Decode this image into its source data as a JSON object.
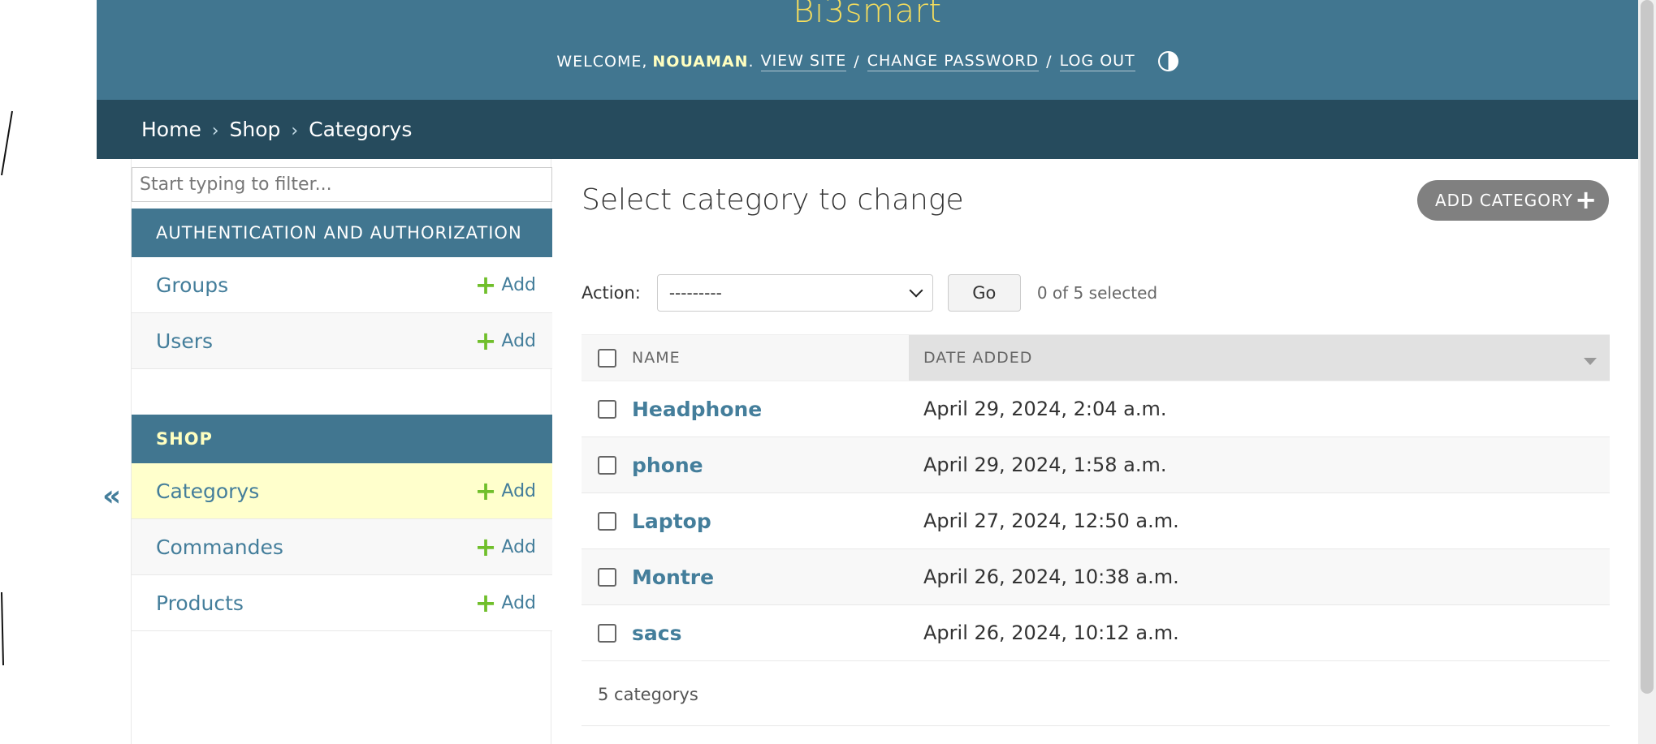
{
  "header": {
    "brand": "Bi3smart",
    "welcome": "WELCOME,",
    "username": "NOUAMAN",
    "user_suffix": ".",
    "view_site": "VIEW SITE",
    "change_password": "CHANGE PASSWORD",
    "log_out": "LOG OUT",
    "separator": "/"
  },
  "breadcrumbs": {
    "home": "Home",
    "shop": "Shop",
    "current": "Categorys",
    "arrow": "›"
  },
  "sidebar": {
    "filter_placeholder": "Start typing to filter...",
    "toggle": "«",
    "auth_module": {
      "caption": "AUTHENTICATION AND AUTHORIZATION",
      "items": [
        {
          "label": "Groups",
          "add": "Add"
        },
        {
          "label": "Users",
          "add": "Add"
        }
      ]
    },
    "shop_module": {
      "caption": "SHOP",
      "items": [
        {
          "label": "Categorys",
          "add": "Add"
        },
        {
          "label": "Commandes",
          "add": "Add"
        },
        {
          "label": "Products",
          "add": "Add"
        }
      ]
    }
  },
  "content": {
    "title": "Select category to change",
    "add_button": "ADD CATEGORY",
    "action_label": "Action:",
    "action_selected": "---------",
    "go_label": "Go",
    "selection_count": "0 of 5 selected",
    "columns": {
      "name": "NAME",
      "date_added": "DATE ADDED"
    },
    "rows": [
      {
        "name": "Headphone",
        "date": "April 29, 2024, 2:04 a.m."
      },
      {
        "name": "phone",
        "date": "April 29, 2024, 1:58 a.m."
      },
      {
        "name": "Laptop",
        "date": "April 27, 2024, 12:50 a.m."
      },
      {
        "name": "Montre",
        "date": "April 26, 2024, 10:38 a.m."
      },
      {
        "name": "sacs",
        "date": "April 26, 2024, 10:12 a.m."
      }
    ],
    "paginator": "5 categorys"
  },
  "colors": {
    "header_bg": "#417690",
    "breadcrumbs_bg": "#264b5d",
    "brand": "#f5dd5d",
    "link": "#447e9b",
    "add_plus": "#70bf2b",
    "current_row": "#ffffcc"
  }
}
